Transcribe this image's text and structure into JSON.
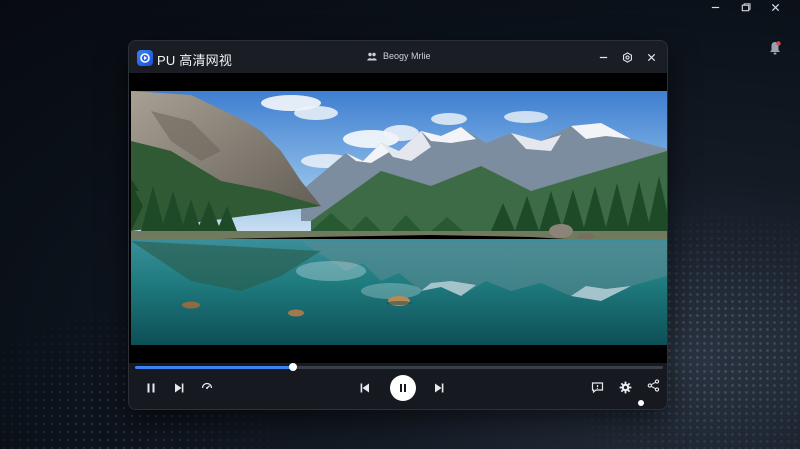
{
  "app": {
    "title": "PU 高清网视",
    "center_title": "Beogy Mrlie"
  },
  "playback": {
    "progress": 0.3,
    "state": "paused"
  },
  "icons": {
    "logo": "app-logo-icon",
    "user": "users-icon",
    "minimize": "minimize-icon",
    "settings": "settings-icon",
    "close": "close-icon",
    "pause": "pause-icon",
    "next": "next-icon",
    "speed": "speed-icon",
    "previous": "previous-icon",
    "play_pause": "play-pause-icon",
    "subtitle": "subtitle-icon",
    "gear": "gear-icon",
    "share": "share-icon"
  },
  "colors": {
    "accent": "#3b82f6",
    "window_bg": "#15191f"
  }
}
